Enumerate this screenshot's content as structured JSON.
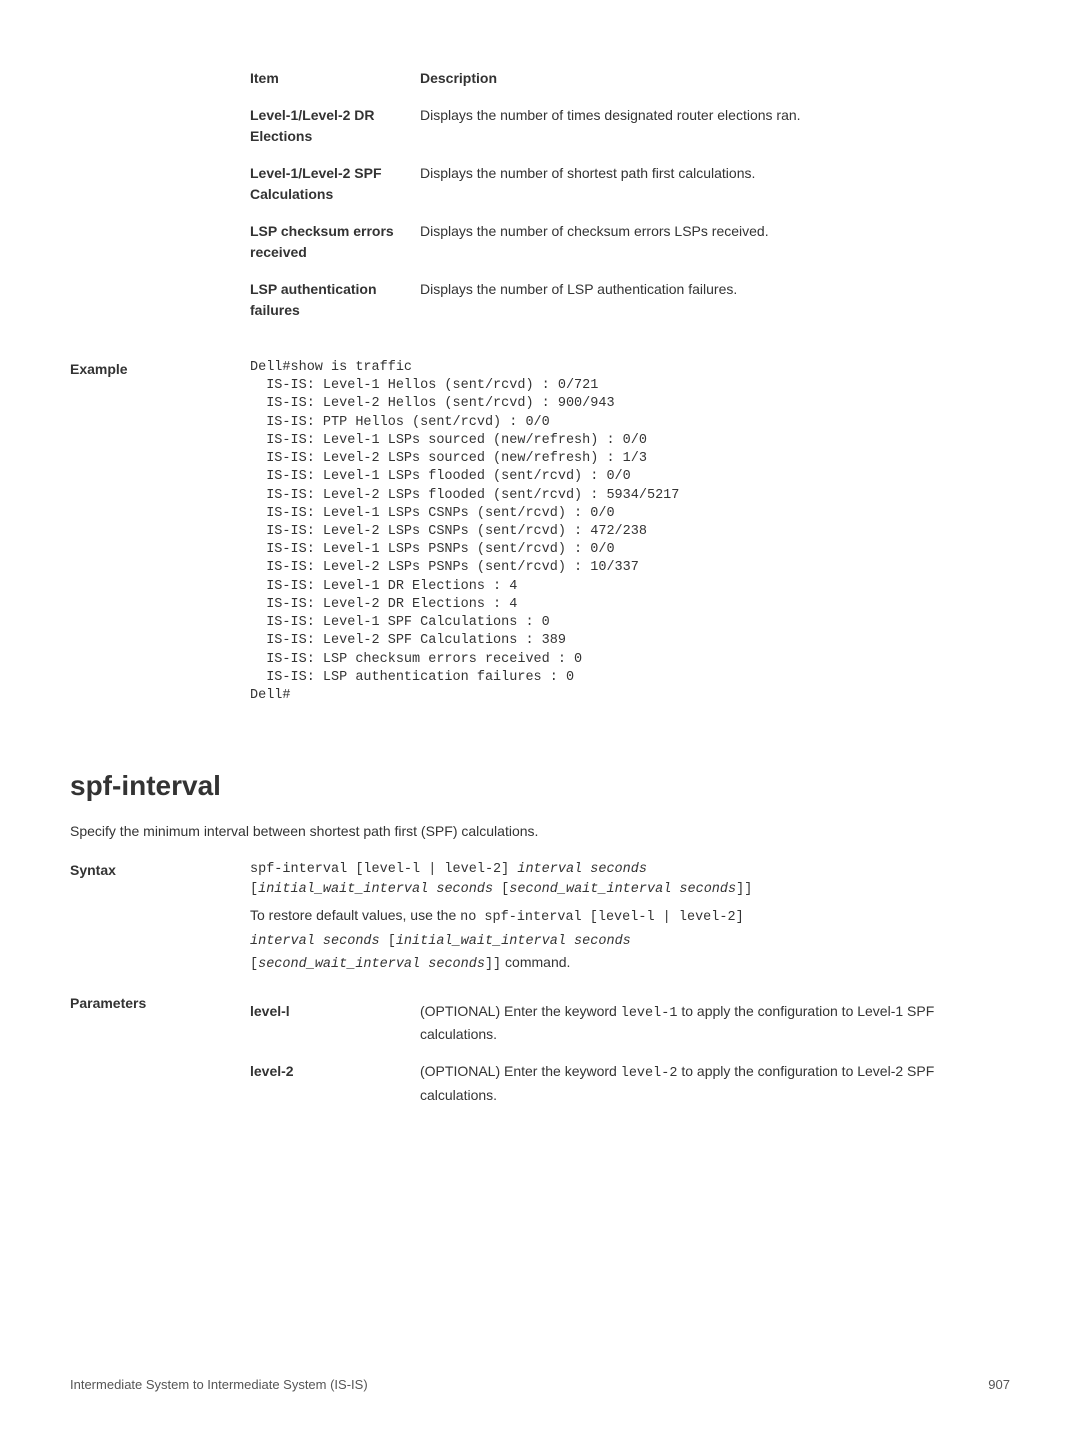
{
  "table": {
    "header": {
      "item": "Item",
      "desc": "Description"
    },
    "rows": [
      {
        "item": "Level-1/Level-2 DR Elections",
        "desc": "Displays the number of times designated router elections ran."
      },
      {
        "item": "Level-1/Level-2 SPF Calculations",
        "desc": "Displays the number of shortest path first calculations."
      },
      {
        "item": "LSP checksum errors received",
        "desc": "Displays the number of checksum errors LSPs received."
      },
      {
        "item": "LSP authentication failures",
        "desc": "Displays the number of LSP authentication failures."
      }
    ]
  },
  "example": {
    "label": "Example",
    "code": "Dell#show is traffic\n  IS-IS: Level-1 Hellos (sent/rcvd) : 0/721\n  IS-IS: Level-2 Hellos (sent/rcvd) : 900/943\n  IS-IS: PTP Hellos (sent/rcvd) : 0/0\n  IS-IS: Level-1 LSPs sourced (new/refresh) : 0/0\n  IS-IS: Level-2 LSPs sourced (new/refresh) : 1/3\n  IS-IS: Level-1 LSPs flooded (sent/rcvd) : 0/0\n  IS-IS: Level-2 LSPs flooded (sent/rcvd) : 5934/5217\n  IS-IS: Level-1 LSPs CSNPs (sent/rcvd) : 0/0\n  IS-IS: Level-2 LSPs CSNPs (sent/rcvd) : 472/238\n  IS-IS: Level-1 LSPs PSNPs (sent/rcvd) : 0/0\n  IS-IS: Level-2 LSPs PSNPs (sent/rcvd) : 10/337\n  IS-IS: Level-1 DR Elections : 4\n  IS-IS: Level-2 DR Elections : 4\n  IS-IS: Level-1 SPF Calculations : 0\n  IS-IS: Level-2 SPF Calculations : 389\n  IS-IS: LSP checksum errors received : 0\n  IS-IS: LSP authentication failures : 0\nDell#"
  },
  "section": {
    "title": "spf-interval",
    "intro": "Specify the minimum interval between shortest path first (SPF) calculations."
  },
  "syntax": {
    "label": "Syntax",
    "line1_a": "spf-interval [level-l | level-2] ",
    "line1_b": "interval seconds",
    "line2_a": "[",
    "line2_b": "initial_wait_interval seconds",
    "line2_c": " [",
    "line2_d": "second_wait_interval seconds",
    "line2_e": "]]",
    "restore_a": "To restore default values, use the ",
    "restore_b": "no spf-interval [level-l | level-2]",
    "restore_c": "interval seconds",
    "restore_d": " [",
    "restore_e": "initial_wait_interval seconds",
    "restore_f": "[",
    "restore_g": "second_wait_interval seconds",
    "restore_h": "]]",
    "restore_i": " command."
  },
  "params": {
    "label": "Parameters",
    "rows": [
      {
        "name": "level-l",
        "desc_a": "(OPTIONAL) Enter the keyword ",
        "desc_b": "level-1",
        "desc_c": " to apply the configuration to Level-1 SPF calculations."
      },
      {
        "name": "level-2",
        "desc_a": "(OPTIONAL) Enter the keyword ",
        "desc_b": "level-2",
        "desc_c": " to apply the configuration to Level-2 SPF calculations."
      }
    ]
  },
  "footer": {
    "left": "Intermediate System to Intermediate System (IS-IS)",
    "right": "907"
  }
}
